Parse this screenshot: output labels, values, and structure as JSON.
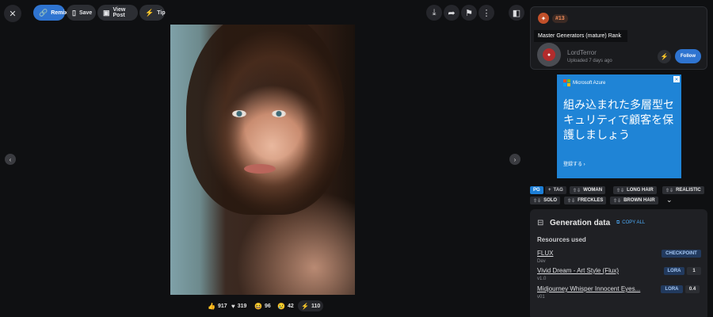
{
  "toolbar": {
    "remix_label": "Remix",
    "save_label": "Save",
    "view_post_label": "View Post",
    "tip_label": "Tip"
  },
  "reactions": [
    {
      "icon": "thumbs-up-icon",
      "glyph": "👍",
      "count": "917"
    },
    {
      "icon": "heart-icon",
      "glyph": "♥",
      "count": "319"
    },
    {
      "icon": "laugh-icon",
      "glyph": "😆",
      "count": "96"
    },
    {
      "icon": "cry-icon",
      "glyph": "😢",
      "count": "42"
    },
    {
      "icon": "bolt-icon",
      "glyph": "⚡",
      "count": "110"
    }
  ],
  "creator": {
    "rank": "#13",
    "rank_label": "Master Generators (mature) Rank",
    "name": "LordTerror",
    "uploaded": "Uploaded 7 days ago",
    "follow_label": "Follow"
  },
  "ad": {
    "brand": "Microsoft Azure",
    "copy": "組み込まれた多層型セキュリティで顧客を保護しましょう",
    "cta": "登録する ›",
    "close": "✕"
  },
  "tags": {
    "rating": "PG",
    "add_label": "TAG",
    "items": [
      "WOMAN",
      "LONG HAIR",
      "REALISTIC",
      "SOLO",
      "FRECKLES",
      "BROWN HAIR"
    ]
  },
  "generation": {
    "title": "Generation data",
    "copy_all": "COPY ALL",
    "resources_title": "Resources used",
    "resources": [
      {
        "name": "FLUX",
        "version": "Dev",
        "type": "CHECKPOINT",
        "weight": ""
      },
      {
        "name": "Vivid Dream - Art Style (Flux)",
        "version": "v1.0",
        "type": "LORA",
        "weight": "1"
      },
      {
        "name": "Midjourney Whisper Innocent Eyes...",
        "version": "v01",
        "type": "LORA",
        "weight": "0.4"
      }
    ]
  },
  "colors": {
    "accent": "#2f74d0",
    "background": "#0f1012",
    "panel": "#1f2024",
    "rank": "#c2502a"
  }
}
